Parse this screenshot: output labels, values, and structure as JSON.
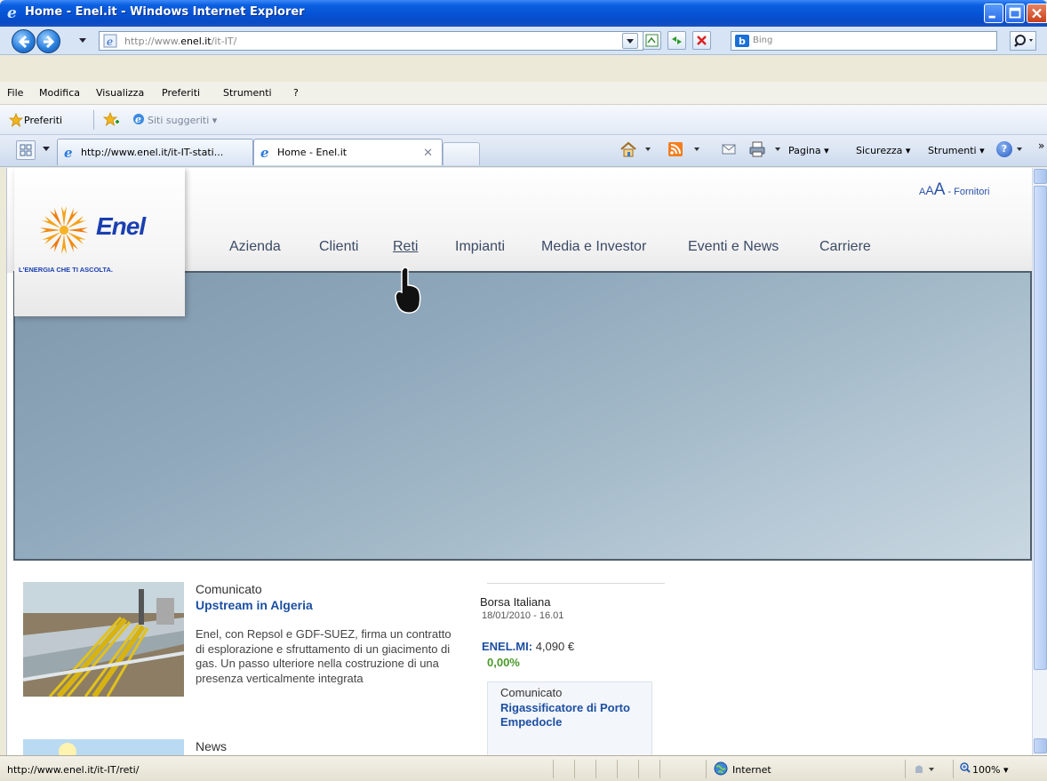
{
  "window": {
    "title": "Home - Enel.it - Windows Internet Explorer"
  },
  "address_bar": {
    "url_prefix": "http://www.",
    "url_domain": "enel.it",
    "url_suffix": "/it-IT/"
  },
  "search": {
    "placeholder": "Bing"
  },
  "menu": [
    "File",
    "Modifica",
    "Visualizza",
    "Preferiti",
    "Strumenti",
    "?"
  ],
  "favorites": {
    "label": "Preferiti",
    "suggested": "Siti suggeriti"
  },
  "tabs": [
    {
      "label": "http://www.enel.it/it-IT-stati...",
      "active": false
    },
    {
      "label": "Home - Enel.it",
      "active": true
    }
  ],
  "command_bar": {
    "page": "Pagina",
    "security": "Sicurezza",
    "tools": "Strumenti"
  },
  "page": {
    "logo": {
      "word": "Enel",
      "tagline": "L'ENERGIA CHE TI ASCOLTA."
    },
    "accessibility": {
      "small": "A",
      "medium": "A",
      "large": "A",
      "separator": " - ",
      "fornitori": "Fornitori"
    },
    "nav": [
      "Azienda",
      "Clienti",
      "Reti",
      "Impianti",
      "Media e Investor",
      "Eventi e News",
      "Carriere"
    ],
    "hovered_nav": "Reti",
    "news": [
      {
        "kicker": "Comunicato",
        "title": "Upstream in Algeria",
        "body": "Enel, con Repsol e GDF-SUEZ, firma un contratto di esplorazione e sfruttamento di un giacimento di gas. Un passo ulteriore nella costruzione di una presenza verticalmente integrata"
      },
      {
        "kicker": "News"
      }
    ],
    "borsa": {
      "title": "Borsa Italiana",
      "datetime": "18/01/2010 - 16.01",
      "ticker": "ENEL.MI:",
      "price": "4,090 €",
      "change": "0,00%",
      "change_color": "#4a9a2a"
    },
    "comunicato_box": {
      "kicker": "Comunicato",
      "title": "Rigassificatore di Porto Empedocle"
    }
  },
  "status": {
    "url": "http://www.enel.it/it-IT/reti/",
    "zone": "Internet",
    "zoom": "100%"
  },
  "colors": {
    "ie_titlebar": "#0652d4",
    "enel_blue": "#1a3fb0",
    "link_blue": "#1c4fa3"
  }
}
